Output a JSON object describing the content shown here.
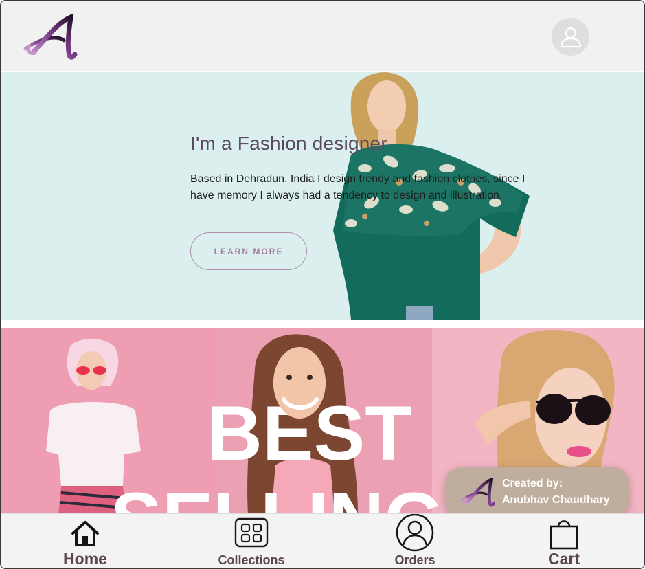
{
  "header": {
    "logo_letter": "A",
    "avatar_icon": "user-avatar-icon"
  },
  "hero": {
    "title": "I'm a Fashion designer",
    "description": "Based in Dehradun, India I design trendy and fashion clothes, since I have memory I always had a tendency to design and illustration.",
    "button_label": "LEARN MORE"
  },
  "banner": {
    "line1": "BEST",
    "line2": "SELLING"
  },
  "credit": {
    "line1": "Created by:",
    "line2": "Anubhav Chaudhary"
  },
  "bottom_nav": {
    "items": [
      {
        "label": "Home",
        "icon": "home-icon"
      },
      {
        "label": "Collections",
        "icon": "collections-icon"
      },
      {
        "label": "Orders",
        "icon": "orders-icon"
      },
      {
        "label": "Cart",
        "icon": "cart-icon"
      }
    ]
  },
  "colors": {
    "header_bg": "#f1f1f1",
    "hero_bg": "#dcefef",
    "accent": "#a47f99",
    "banner_bg": "#ef9fb4",
    "credit_bg": "#bfae9e",
    "nav_label": "#5a4552"
  }
}
